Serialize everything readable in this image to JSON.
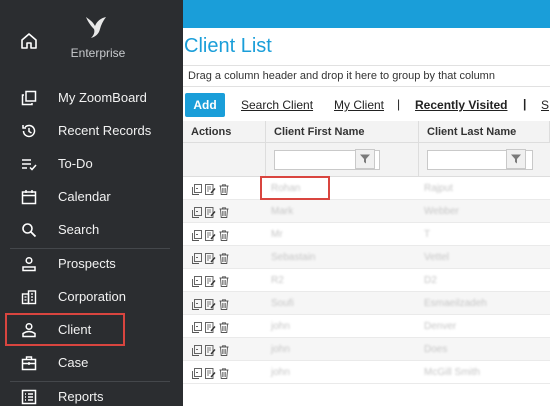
{
  "sidebar": {
    "brand": "Enterprise",
    "items": [
      {
        "label": "My ZoomBoard",
        "icon": "zoomboard-icon"
      },
      {
        "label": "Recent Records",
        "icon": "history-icon"
      },
      {
        "label": "To-Do",
        "icon": "todo-list-icon"
      },
      {
        "label": "Calendar",
        "icon": "calendar-icon"
      },
      {
        "label": "Search",
        "icon": "search-icon"
      },
      {
        "label": "Prospects",
        "icon": "prospects-icon"
      },
      {
        "label": "Corporation",
        "icon": "corporation-icon"
      },
      {
        "label": "Client",
        "icon": "client-icon"
      },
      {
        "label": "Case",
        "icon": "case-icon"
      },
      {
        "label": "Reports",
        "icon": "reports-icon"
      }
    ]
  },
  "main": {
    "title": "Client List",
    "group_hint": "Drag a column header and drop it here to group by that column",
    "toolbar": {
      "add_label": "Add",
      "links": [
        "Search Client",
        "My Client",
        "Recently Visited",
        "S"
      ],
      "separators": [
        "|",
        "|"
      ]
    },
    "grid": {
      "columns": [
        "Actions",
        "Client First Name",
        "Client Last Name"
      ],
      "rows": [
        {
          "first": "Rohan",
          "last": "Rajput"
        },
        {
          "first": "Mark",
          "last": "Webber"
        },
        {
          "first": "Mr",
          "last": "T"
        },
        {
          "first": "Sebastain",
          "last": "Vettel"
        },
        {
          "first": "R2",
          "last": "D2"
        },
        {
          "first": "Soufi",
          "last": "Esmaeilzadeh"
        },
        {
          "first": "john",
          "last": "Denver"
        },
        {
          "first": "john",
          "last": "Does"
        },
        {
          "first": "john",
          "last": "McGill Smith"
        }
      ]
    }
  },
  "colors": {
    "accent": "#1a9ed9",
    "sidebar_bg": "#2b2d30",
    "highlight": "#d9453f"
  }
}
